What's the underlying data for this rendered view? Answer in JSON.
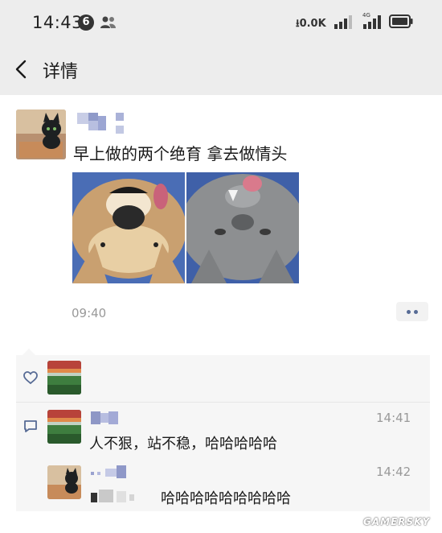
{
  "status_bar": {
    "time": "14:43",
    "notification_count": "6",
    "network_speed": "0.0K",
    "icons": [
      "people-icon",
      "download-arrow-icon",
      "signal-icon",
      "4g-signal-icon",
      "battery-icon"
    ]
  },
  "nav": {
    "back_icon": "chevron-left-icon",
    "title": "详情"
  },
  "post": {
    "text": "早上做的两个绝育  拿去做情头",
    "photos": [
      {
        "subject": "dog-upside-down"
      },
      {
        "subject": "cat-upside-down"
      }
    ],
    "time": "09:40",
    "more_icon": "two-dots-icon"
  },
  "interactions": {
    "like_icon": "heart-icon",
    "comment_icon": "comment-bubble-icon",
    "comments": [
      {
        "text": "人不狠，站不稳，哈哈哈哈哈",
        "time": "14:41"
      },
      {
        "text": "哈哈哈哈哈哈哈哈哈",
        "time": "14:42"
      }
    ]
  },
  "watermark": "GAMERSKY",
  "colors": {
    "header_bg": "#ededed",
    "link_blue": "#576b95",
    "muted_text": "#999999",
    "interaction_bg": "#f6f6f6"
  }
}
